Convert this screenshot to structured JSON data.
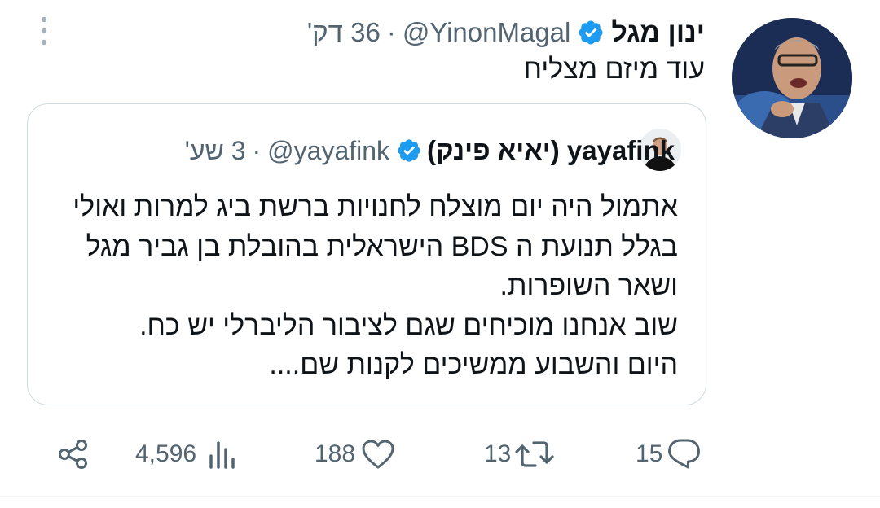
{
  "tweet": {
    "author_name": "ינון מגל",
    "handle": "@YinonMagal",
    "separator": "·",
    "time": "36 דק'",
    "text": "עוד מיזם מצליח"
  },
  "quoted_tweet": {
    "author_name": "yayafink (יאיא פינק)",
    "handle": "@yayafink",
    "separator": "·",
    "time": "3 שע'",
    "lines": [
      "אתמול היה יום מוצלח לחנויות ברשת ביג למרות ואולי",
      "בגלל תנועת ה BDS הישראלית בהובלת בן גביר מגל",
      "ושאר השופרות.",
      "שוב אנחנו מוכיחים שגם לציבור הליברלי יש כח.",
      "היום והשבוע ממשיכים לקנות שם...."
    ]
  },
  "actions": {
    "replies": "15",
    "retweets": "13",
    "likes": "188",
    "views": "4,596"
  },
  "colors": {
    "verified": "#1d9bf0",
    "secondary_text": "#536471",
    "border": "#cfd9de"
  },
  "icons": [
    "more-vertical-icon",
    "verified-icon",
    "reply-icon",
    "retweet-icon",
    "like-icon",
    "views-icon",
    "share-icon"
  ]
}
